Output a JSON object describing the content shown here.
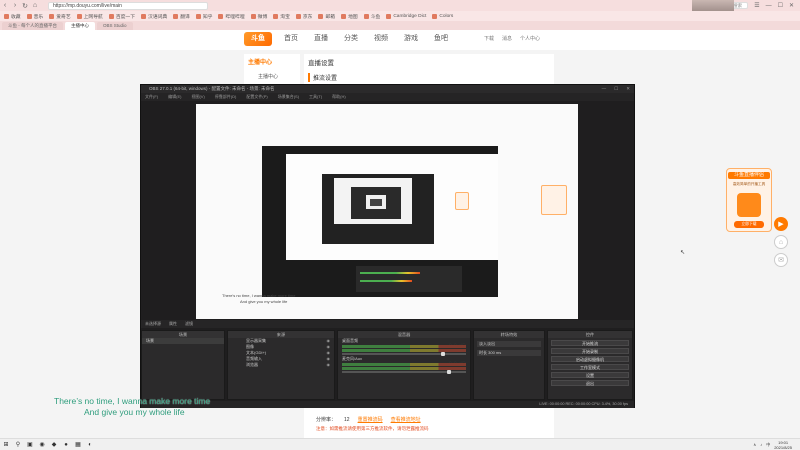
{
  "browser": {
    "back": "‹",
    "forward": "›",
    "reload": "↻",
    "home": "⌂",
    "url": "https://mp.douyu.com/live/main",
    "search_placeholder": "在作用量游戏搜索",
    "bookmarks": [
      "收藏",
      "音乐",
      "爱奇艺",
      "上网导航",
      "百度一下",
      "汉语词典",
      "翻译",
      "知乎",
      "哔哩哔哩",
      "微博",
      "淘宝",
      "京东",
      "邮箱",
      "地图",
      "斗鱼",
      "Cambridge Dict",
      "Colors"
    ],
    "tabs": [
      {
        "label": "斗鱼 - 每个人的直播平台",
        "active": false
      },
      {
        "label": "主播中心",
        "active": true
      },
      {
        "label": "OBS Studio",
        "active": false
      }
    ]
  },
  "douyu": {
    "logo": "斗鱼",
    "nav": [
      "首页",
      "直播",
      "分类",
      "视频",
      "游戏",
      "鱼吧"
    ],
    "header_right": [
      "下载",
      "消息",
      "个人中心"
    ],
    "left_title": "主播中心",
    "left_item": "主播中心",
    "right_title": "直播设置",
    "right_sub": "推流设置",
    "bottom_label": "分辨率：",
    "bottom_value": "12",
    "bottom_link1": "重置推流码",
    "bottom_link2": "查看推流地址",
    "bottom_warning": "注意：如需推流请使用第三方推流软件，请勿泄露推流码",
    "promo_title": "斗鱼直播伴侣",
    "promo_sub": "高效简单的开播工具",
    "promo_button": "立即下载"
  },
  "obs": {
    "title": "OBS 27.0.1 (64-bit, windows) - 配置文件: 未命名 - 场景: 未命名",
    "menu": [
      "文件(F)",
      "编辑(E)",
      "视图(V)",
      "停靠部件(D)",
      "配置文件(P)",
      "场景集合(S)",
      "工具(T)",
      "帮助(H)"
    ],
    "status_bar": [
      "未选择源",
      "属性",
      "滤镜"
    ],
    "docks": {
      "scenes": {
        "title": "场景",
        "items": [
          "场景"
        ]
      },
      "sources": {
        "title": "来源",
        "items": [
          "显示器采集",
          "图像",
          "文本(GDI+)",
          "音频输入",
          "浏览器"
        ]
      },
      "mixer": {
        "title": "混音器",
        "channels": [
          {
            "name": "桌面音频",
            "level": "0.0 dB",
            "volume": 0.8
          },
          {
            "name": "麦克风/Aux",
            "level": "0.0 dB",
            "volume": 0.85
          }
        ]
      },
      "transitions": {
        "title": "转场特效",
        "type": "淡入淡出",
        "duration_label": "时长",
        "duration": "300 ms"
      },
      "controls": {
        "title": "控件",
        "buttons": [
          "开始推流",
          "开始录制",
          "启动虚拟摄像机",
          "工作室模式",
          "设置",
          "退出"
        ]
      }
    },
    "bottom_status": "LIVE: 00:00:00   REC: 00:00:00   CPU: 3.4%, 30.00 fps"
  },
  "preview_caption": [
    "There's no time, I wanna make more time",
    "And give you my whole life"
  ],
  "subtitles": {
    "line1": "There’s no time, I wanna make more time",
    "line2": "And give you my whole life"
  },
  "taskbar": {
    "start": "⊞",
    "search": "⚲",
    "apps": [
      "▣",
      "◉",
      "◆",
      "●",
      "▦",
      "◐"
    ],
    "tray": [
      "∧",
      "♪",
      "中"
    ],
    "time": "19:01",
    "date": "2021/8/25"
  }
}
